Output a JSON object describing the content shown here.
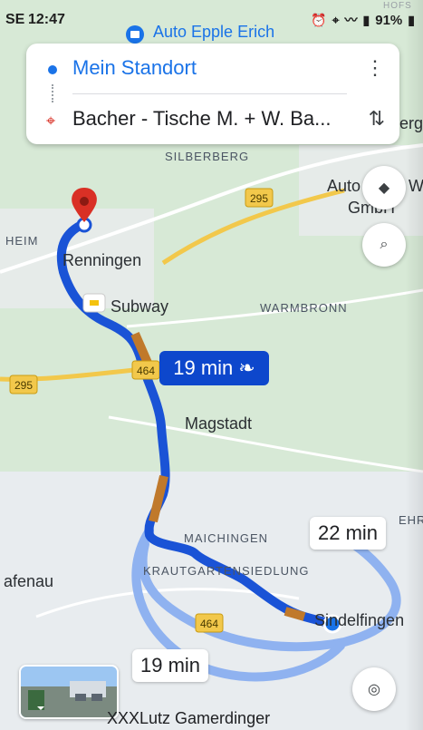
{
  "status_bar": {
    "left_clip": "SE",
    "time": "12:47",
    "battery": "91%"
  },
  "search": {
    "origin": "Mein Standort",
    "destination": "Bacher - Tische M. + W. Ba..."
  },
  "map": {
    "top_place": "Auto Epple Erich",
    "places": {
      "silberberg": "SILBERBERG",
      "renningen": "Renningen",
      "subway": "Subway",
      "warmbronn": "WARMBRONN",
      "magstadt": "Magstadt",
      "maichingen": "MAICHINGEN",
      "krautgartensiedlung": "KRAUTGARTENSIEDLUNG",
      "sindelfingen": "Sindelfingen",
      "afenau": "afenau",
      "auto_right": "Auto",
      "gmbh": "GmbH",
      "heim": "HEIM",
      "ehr": "EHR",
      "bottom": "XXXLutz Gamerdinger",
      "erg": "erg",
      "w_label": "W",
      "top_right_edge": "HOFS"
    },
    "roads": [
      "295",
      "295",
      "464",
      "464"
    ],
    "routes": {
      "main_time": "19 min",
      "alt1_time": "22 min",
      "alt2_time": "19 min"
    }
  },
  "colors": {
    "primary": "#1a73e8",
    "route": "#1a53d6",
    "route_alt": "#8fb2f0",
    "pin": "#d93025",
    "traffic": "#c0792b"
  },
  "icons": {
    "origin": "blue-dot",
    "destination": "pin-icon",
    "menu": "more-vert-icon",
    "swap": "swap-vert-icon",
    "layers": "layers-icon",
    "search": "search-icon",
    "locate": "my-location-icon",
    "leaf": "eco-leaf-icon",
    "street_view": "street-view-thumbnail"
  }
}
